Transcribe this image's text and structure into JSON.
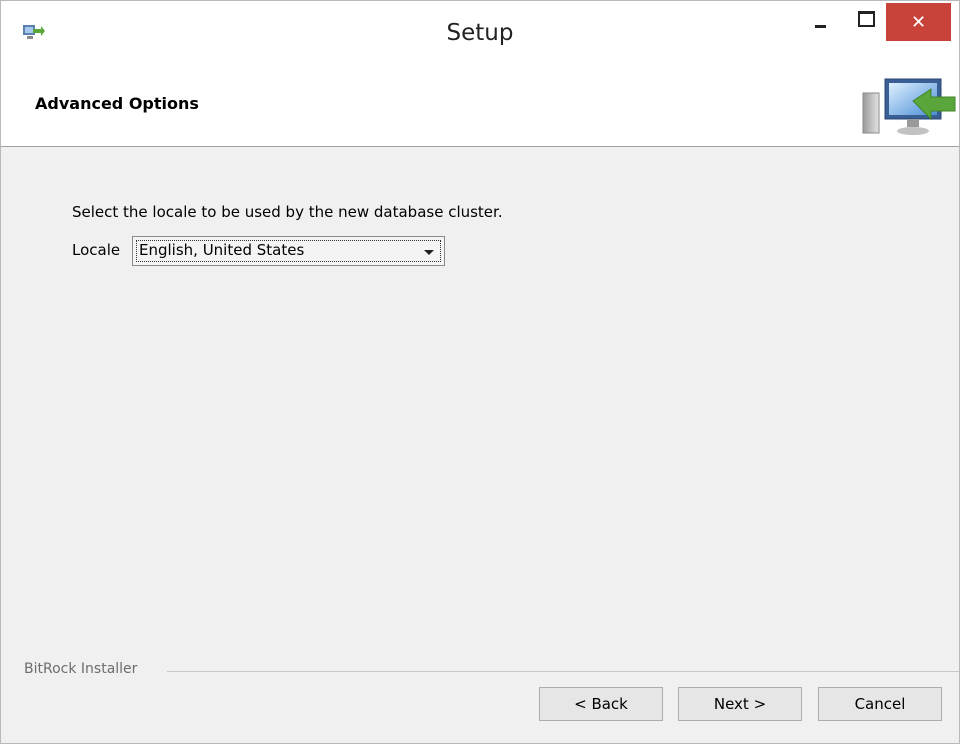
{
  "window": {
    "title": "Setup",
    "close_glyph": "✕",
    "icons": {
      "app": "setup-app-icon",
      "minimize": "minimize-icon",
      "maximize": "maximize-icon",
      "close": "close-icon"
    }
  },
  "header": {
    "title": "Advanced Options",
    "logo_icon": "computer-install-arrow-icon"
  },
  "main": {
    "instruction": "Select the locale to be used by the new database cluster.",
    "locale_label": "Locale",
    "locale_value": "English, United States"
  },
  "footer": {
    "group_label": "BitRock Installer",
    "back_label": "< Back",
    "next_label": "Next >",
    "cancel_label": "Cancel"
  },
  "colors": {
    "close_button": "#c7433a",
    "window_bg": "#f0f0f0",
    "button_bg": "#e6e6e6"
  }
}
